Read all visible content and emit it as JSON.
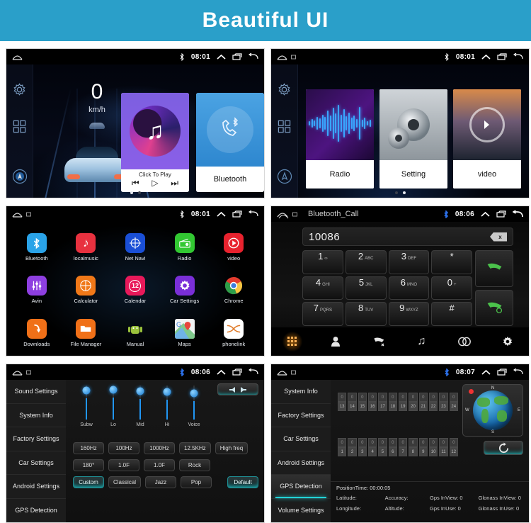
{
  "banner": {
    "title": "Beautiful  UI",
    "bg_color": "#2a9fc9"
  },
  "screens": {
    "home": {
      "status": {
        "time": "08:01",
        "bluetooth_icon": "bluetooth-icon",
        "expand_icon": "chevron-up-icon",
        "recents_icon": "recents-icon",
        "back_icon": "back-icon"
      },
      "rail": [
        {
          "name": "settings-gear",
          "icon": "gear-icon"
        },
        {
          "name": "apps-grid",
          "icon": "grid-icon"
        },
        {
          "name": "navigation",
          "icon": "nav-circle-icon"
        }
      ],
      "speed": {
        "value": "0",
        "unit": "km/h"
      },
      "music_widget": {
        "caption": "Click To Play",
        "prev_icon": "prev-track-icon",
        "play_icon": "play-icon",
        "next_icon": "next-track-icon",
        "art_icon": "music-note-icon"
      },
      "bluetooth_widget": {
        "label": "Bluetooth",
        "icon": "bluetooth-phone-icon"
      },
      "page_dots": 2,
      "active_dot": 0
    },
    "widgets": {
      "status": {
        "time": "08:01"
      },
      "items": [
        {
          "label": "Radio",
          "art": "audio-wave"
        },
        {
          "label": "Setting",
          "art": "gears"
        },
        {
          "label": "video",
          "art": "movie-play"
        }
      ],
      "page_dots": 2,
      "active_dot": 1
    },
    "apps": {
      "status": {
        "time": "08:01"
      },
      "items": [
        {
          "label": "Bluetooth",
          "glyph": "B",
          "icon": "bluetooth-icon",
          "color": "#2aa3e8"
        },
        {
          "label": "localmusic",
          "glyph": "♪",
          "icon": "music-note-icon",
          "color": "#e8313f"
        },
        {
          "label": "Net Navi",
          "glyph": "✲",
          "icon": "compass-icon",
          "color": "#1a4fd6"
        },
        {
          "label": "Radio",
          "glyph": "▤",
          "icon": "radio-icon",
          "color": "#32c832"
        },
        {
          "label": "video",
          "glyph": "▶",
          "icon": "play-circle-icon",
          "color": "#e8222e"
        },
        {
          "label": "Avin",
          "glyph": "↕",
          "icon": "equalizer-icon",
          "color": "#8e3fe0"
        },
        {
          "label": "Calculator",
          "glyph": "⊞",
          "icon": "calculator-icon",
          "color": "#f07818"
        },
        {
          "label": "Calendar",
          "glyph": "12",
          "icon": "calendar-icon",
          "color": "#e8195a"
        },
        {
          "label": "Car Settings",
          "glyph": "⚙",
          "icon": "gear-icon",
          "color": "#7a2fd8"
        },
        {
          "label": "Chrome",
          "glyph": "●",
          "icon": "chrome-icon",
          "color": "#ffffff"
        },
        {
          "label": "Downloads",
          "glyph": "↓",
          "icon": "download-icon",
          "color": "#f07018"
        },
        {
          "label": "File Manager",
          "glyph": "▰",
          "icon": "folder-icon",
          "color": "#f07018"
        },
        {
          "label": "Manual",
          "glyph": "●",
          "icon": "android-icon",
          "color": "#0d0d0d"
        },
        {
          "label": "Maps",
          "glyph": "◆",
          "icon": "maps-pin-icon",
          "color": "#3c9b4f"
        },
        {
          "label": "phonelink",
          "glyph": "✕",
          "icon": "phonelink-icon",
          "color": "#ffffff"
        }
      ]
    },
    "dialer": {
      "status": {
        "title": "Bluetooth_Call",
        "time": "08:06",
        "home_icon": "home-icon"
      },
      "number": "10086",
      "backspace_label": "x",
      "keys": [
        {
          "digit": "1",
          "sub": "∞"
        },
        {
          "digit": "2",
          "sub": "ABC"
        },
        {
          "digit": "3",
          "sub": "DEF"
        },
        {
          "digit": "*",
          "sub": ""
        },
        {
          "digit": "4",
          "sub": "GHI"
        },
        {
          "digit": "5",
          "sub": "JKL"
        },
        {
          "digit": "6",
          "sub": "MNO"
        },
        {
          "digit": "0",
          "sub": "+"
        },
        {
          "digit": "7",
          "sub": "PQRS"
        },
        {
          "digit": "8",
          "sub": "TUV"
        },
        {
          "digit": "9",
          "sub": "WXYZ"
        },
        {
          "digit": "#",
          "sub": ""
        }
      ],
      "call_button": "call-answer-icon",
      "hangup_button": "call-end-icon",
      "bottom_nav": [
        {
          "name": "dialpad-tab",
          "icon": "dialpad-icon",
          "active": true
        },
        {
          "name": "contacts-tab",
          "icon": "person-icon",
          "active": false
        },
        {
          "name": "call-history-tab",
          "icon": "call-history-icon",
          "active": false
        },
        {
          "name": "music-tab",
          "icon": "music-note-icon",
          "active": false
        },
        {
          "name": "pair-tab",
          "icon": "link-icon",
          "active": false
        },
        {
          "name": "settings-tab",
          "icon": "gear-icon",
          "active": false
        }
      ]
    },
    "sound": {
      "status": {
        "time": "08:06"
      },
      "sidebar": [
        {
          "label": "Sound Settings",
          "active": false
        },
        {
          "label": "System Info",
          "active": false
        },
        {
          "label": "Factory Settings",
          "active": false
        },
        {
          "label": "Car Settings",
          "active": false
        },
        {
          "label": "Android Settings",
          "active": false
        },
        {
          "label": "GPS Detection",
          "active": false
        }
      ],
      "speaker_button": "balance-icon",
      "sliders": [
        {
          "label": "Subw",
          "value": 62
        },
        {
          "label": "Lo",
          "value": 64
        },
        {
          "label": "Mid",
          "value": 60
        },
        {
          "label": "Hi",
          "value": 58
        },
        {
          "label": "Voice",
          "value": 54
        }
      ],
      "freq_row": [
        "160Hz",
        "100Hz",
        "1000Hz",
        "12.5KHz",
        "High freq"
      ],
      "param_row": [
        "180°",
        "1.0F",
        "1.0F",
        "Rock"
      ],
      "preset_row": [
        "Custom",
        "Classical",
        "Jazz",
        "Pop"
      ],
      "selected_preset": "Custom",
      "default_button": "Default"
    },
    "gps": {
      "status": {
        "time": "08:07"
      },
      "sidebar": [
        {
          "label": "System Info",
          "active": false
        },
        {
          "label": "Factory Settings",
          "active": false
        },
        {
          "label": "Car Settings",
          "active": false
        },
        {
          "label": "Android Settings",
          "active": false
        },
        {
          "label": "GPS Detection",
          "active": true
        },
        {
          "label": "Volume Settings",
          "active": false
        }
      ],
      "sat_top": {
        "values": [
          "0",
          "0",
          "0",
          "0",
          "0",
          "0",
          "0",
          "0",
          "0",
          "0",
          "0",
          "0"
        ],
        "labels": [
          "13",
          "14",
          "15",
          "16",
          "17",
          "18",
          "19",
          "20",
          "21",
          "22",
          "23",
          "24"
        ]
      },
      "sat_bottom": {
        "values": [
          "0",
          "0",
          "0",
          "0",
          "0",
          "0",
          "0",
          "0",
          "0",
          "0",
          "0",
          "0"
        ],
        "labels": [
          "1",
          "2",
          "3",
          "4",
          "5",
          "6",
          "7",
          "8",
          "9",
          "10",
          "11",
          "12"
        ]
      },
      "compass": {
        "n": "N",
        "s": "S",
        "w": "W",
        "e": "E"
      },
      "refresh_button": "refresh-icon",
      "info": {
        "position_time": "PositionTime: 00:00:05",
        "row1": [
          "Latitude:",
          "Accuracy:",
          "Gps InView: 0",
          "Glonass InView: 0"
        ],
        "row2": [
          "Longitude:",
          "Altitude:",
          "Gps InUse: 0",
          "Glonass InUse: 0"
        ]
      }
    }
  }
}
